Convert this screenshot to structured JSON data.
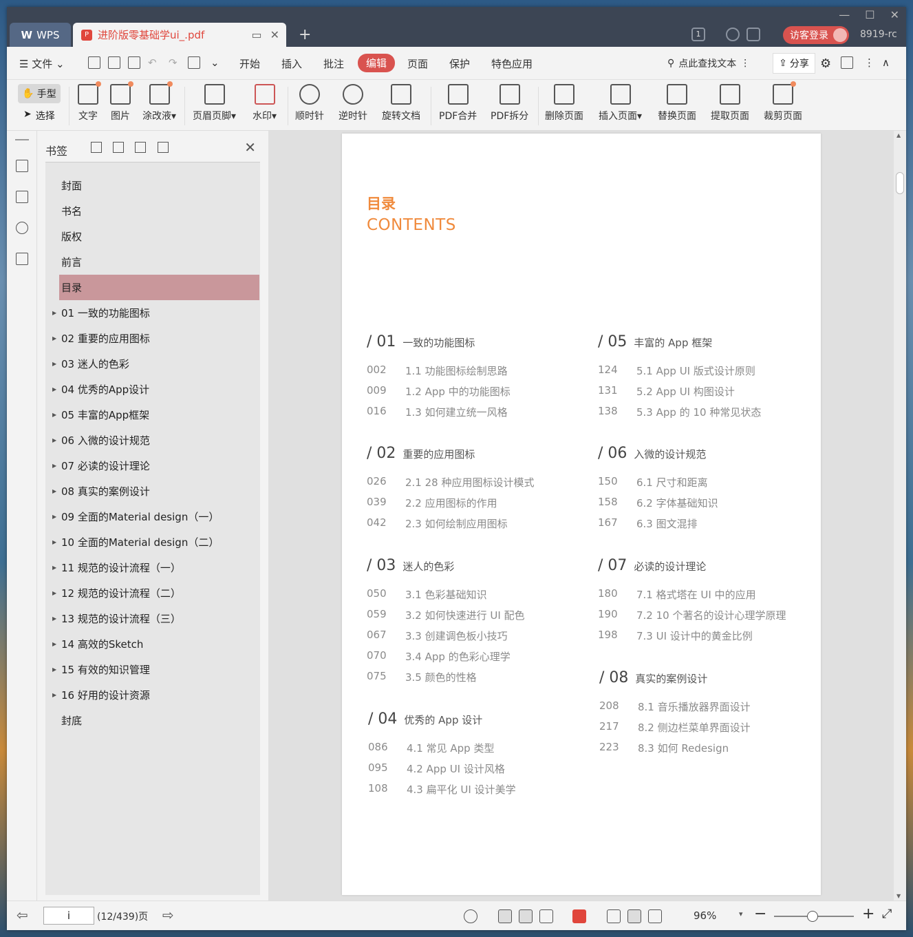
{
  "app": {
    "brand": "WPS",
    "doc_tab": "进阶版零基础学ui_.pdf",
    "login": "访客登录",
    "user_id": "8919-rc",
    "badge": "1"
  },
  "menu": {
    "file": "文件",
    "items": [
      "开始",
      "插入",
      "批注",
      "编辑",
      "页面",
      "保护",
      "特色应用"
    ],
    "active": "编辑",
    "search": "点此查找文本",
    "share": "分享"
  },
  "toolbar": {
    "hand": "手型",
    "select": "选择",
    "tools": [
      "文字",
      "图片",
      "涂改液",
      "页眉页脚",
      "水印",
      "顺时针",
      "逆时针",
      "旋转文档",
      "PDF合并",
      "PDF拆分",
      "删除页面",
      "插入页面",
      "替换页面",
      "提取页面",
      "裁剪页面"
    ]
  },
  "bookmarks": {
    "title": "书签",
    "items": [
      {
        "label": "封面",
        "caret": false
      },
      {
        "label": "书名",
        "caret": false
      },
      {
        "label": "版权",
        "caret": false
      },
      {
        "label": "前言",
        "caret": false
      },
      {
        "label": "目录",
        "caret": false,
        "selected": true
      },
      {
        "label": "01  一致的功能图标",
        "caret": true
      },
      {
        "label": "02  重要的应用图标",
        "caret": true
      },
      {
        "label": "03  迷人的色彩",
        "caret": true
      },
      {
        "label": "04  优秀的App设计",
        "caret": true
      },
      {
        "label": "05  丰富的App框架",
        "caret": true
      },
      {
        "label": "06  入微的设计规范",
        "caret": true
      },
      {
        "label": "07  必读的设计理论",
        "caret": true
      },
      {
        "label": "08  真实的案例设计",
        "caret": true
      },
      {
        "label": "09  全面的Material design（一）",
        "caret": true
      },
      {
        "label": "10  全面的Material design（二）",
        "caret": true
      },
      {
        "label": "11  规范的设计流程（一）",
        "caret": true
      },
      {
        "label": "12  规范的设计流程（二）",
        "caret": true
      },
      {
        "label": "13  规范的设计流程（三）",
        "caret": true
      },
      {
        "label": "14  高效的Sketch",
        "caret": true
      },
      {
        "label": "15  有效的知识管理",
        "caret": true
      },
      {
        "label": "16  好用的设计资源",
        "caret": true
      },
      {
        "label": "封底",
        "caret": false
      }
    ]
  },
  "toc": {
    "title_cn": "目录",
    "title_en": "CONTENTS",
    "chapters": [
      {
        "num": "/ 01",
        "title": "一致的功能图标",
        "secs": [
          [
            "002",
            "1.1 功能图标绘制思路"
          ],
          [
            "009",
            "1.2 App 中的功能图标"
          ],
          [
            "016",
            "1.3 如何建立统一风格"
          ]
        ]
      },
      {
        "num": "/ 02",
        "title": "重要的应用图标",
        "secs": [
          [
            "026",
            "2.1 28 种应用图标设计模式"
          ],
          [
            "039",
            "2.2 应用图标的作用"
          ],
          [
            "042",
            "2.3 如何绘制应用图标"
          ]
        ]
      },
      {
        "num": "/ 03",
        "title": "迷人的色彩",
        "secs": [
          [
            "050",
            "3.1 色彩基础知识"
          ],
          [
            "059",
            "3.2 如何快速进行 UI 配色"
          ],
          [
            "067",
            "3.3 创建调色板小技巧"
          ],
          [
            "070",
            "3.4 App 的色彩心理学"
          ],
          [
            "075",
            "3.5 颜色的性格"
          ]
        ]
      },
      {
        "num": "/ 04",
        "title": "优秀的 App 设计",
        "secs": [
          [
            "086",
            "4.1 常见 App 类型"
          ],
          [
            "095",
            "4.2 App UI 设计风格"
          ],
          [
            "108",
            "4.3 扁平化 UI 设计美学"
          ]
        ]
      },
      {
        "num": "/ 05",
        "title": "丰富的 App 框架",
        "secs": [
          [
            "124",
            "5.1 App UI 版式设计原则"
          ],
          [
            "131",
            "5.2 App UI 构图设计"
          ],
          [
            "138",
            "5.3 App 的 10 种常见状态"
          ]
        ]
      },
      {
        "num": "/ 06",
        "title": "入微的设计规范",
        "secs": [
          [
            "150",
            "6.1 尺寸和距离"
          ],
          [
            "158",
            "6.2 字体基础知识"
          ],
          [
            "167",
            "6.3 图文混排"
          ]
        ]
      },
      {
        "num": "/ 07",
        "title": "必读的设计理论",
        "secs": [
          [
            "180",
            "7.1 格式塔在 UI 中的应用"
          ],
          [
            "190",
            "7.2 10 个著名的设计心理学原理"
          ],
          [
            "198",
            "7.3 UI 设计中的黄金比例"
          ]
        ]
      },
      {
        "num": "/ 08",
        "title": "真实的案例设计",
        "secs": [
          [
            "208",
            "8.1 音乐播放器界面设计"
          ],
          [
            "217",
            "8.2 侧边栏菜单界面设计"
          ],
          [
            "223",
            "8.3 如何 Redesign"
          ]
        ]
      }
    ]
  },
  "status": {
    "page_input": "i",
    "page_total": "(12/439)页",
    "zoom": "96%"
  },
  "colors": {
    "accent": "#d9534f",
    "toc_orange": "#f08a3c",
    "bookmark_sel": "#c9979b"
  }
}
